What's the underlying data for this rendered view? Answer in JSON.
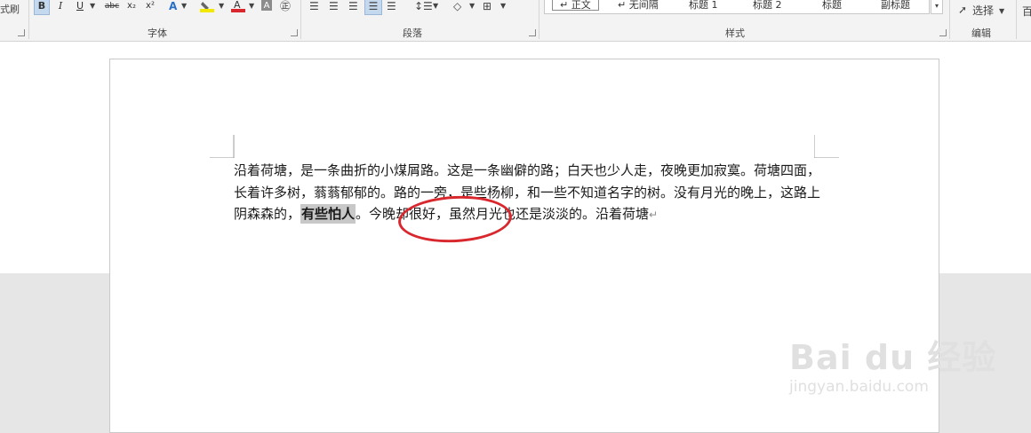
{
  "ribbon": {
    "clipboard": {
      "format_painter_partial": "式刷"
    },
    "font": {
      "group_label": "字体",
      "bold": "B",
      "italic": "I",
      "underline": "U",
      "strikethrough": "abc",
      "subscript": "x₂",
      "superscript": "x²"
    },
    "paragraph": {
      "group_label": "段落"
    },
    "styles": {
      "group_label": "样式",
      "items": [
        "↵ 正文",
        "↵ 无间隔",
        "标题 1",
        "标题 2",
        "标题",
        "副标题"
      ]
    },
    "editing": {
      "group_label": "编辑",
      "select_label": "选择"
    },
    "partial_right": "百"
  },
  "document": {
    "text_before": "沿着荷塘，是一条曲折的小煤屑路。这是一条幽僻的路；白天也少人走，夜晚更加寂寞。荷塘四面，长着许多树，蓊蓊郁郁的。路的一旁，是些杨柳，和一些不知道名字的树。没有月光的晚上，这路上阴森森的，",
    "highlighted_text": "有些怕人",
    "text_after": "。今晚却很好，虽然月光也还是淡淡的。沿着荷塘",
    "paragraph_mark": "↵"
  },
  "watermark": {
    "logo": "Bai du 经验",
    "url": "jingyan.baidu.com"
  },
  "colors": {
    "highlight_gray": "#c8c8c8",
    "annotation_red": "#d9272e",
    "ribbon_bg": "#f3f3f3"
  }
}
